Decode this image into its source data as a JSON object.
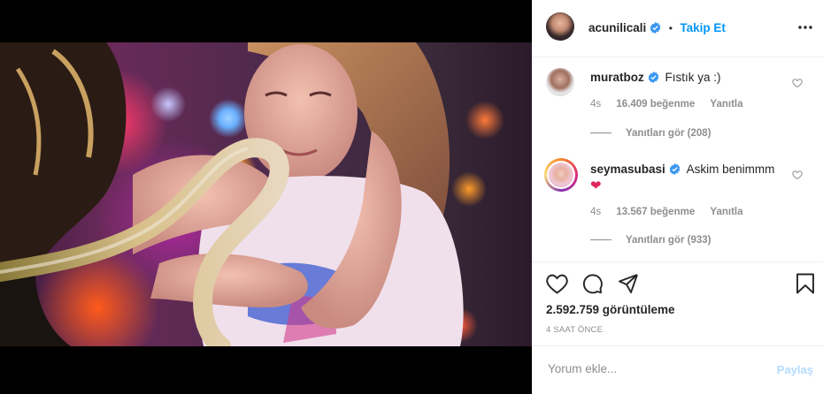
{
  "post": {
    "username": "acunilicali",
    "follow_label": "Takip Et",
    "separator": "•",
    "more_icon": "more-options-icon"
  },
  "comments": [
    {
      "username": "muratboz",
      "text": "Fıstık ya :)",
      "age": "4s",
      "likes": "16.409 beğenme",
      "reply_label": "Yanıtla",
      "view_replies": "Yanıtları gör (208)"
    },
    {
      "username": "seymasubasi",
      "text": "Askim benimmm",
      "emoji": "❤",
      "age": "4s",
      "likes": "13.567 beğenme",
      "reply_label": "Yanıtla",
      "view_replies": "Yanıtları gör (933)"
    }
  ],
  "stats": {
    "views": "2.592.759 görüntüleme",
    "time_ago": "4 SAAT ÖNCE"
  },
  "comment_input": {
    "placeholder": "Yorum ekle...",
    "share_label": "Paylaş"
  },
  "colors": {
    "link_blue": "#0095f6",
    "share_disabled": "#b3dbff",
    "secondary_text": "#8e8e8e",
    "verified_blue": "#3897f0"
  }
}
